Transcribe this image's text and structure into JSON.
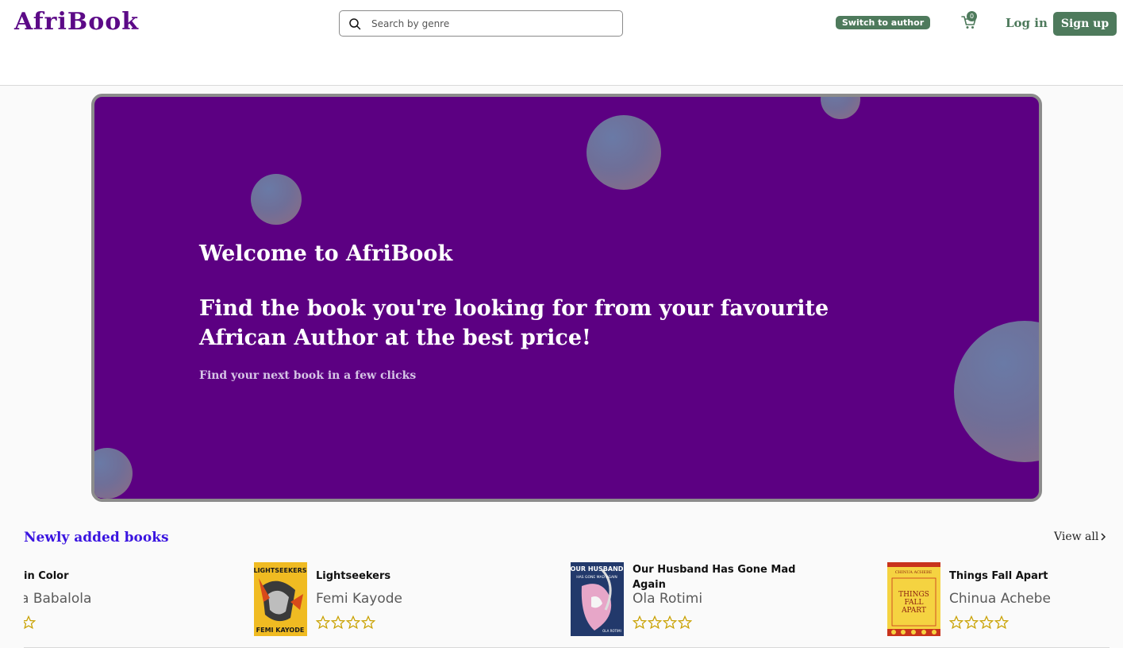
{
  "header": {
    "logo": "AfriBook",
    "search_placeholder": "Search by genre",
    "switch_label": "Switch to author",
    "cart_count": "0",
    "login_label": "Log in",
    "signup_label": "Sign up"
  },
  "hero": {
    "title": "Welcome to AfriBook",
    "headline": "Find the book you're looking for from your favourite African Author at the best price!",
    "subtitle": "Find your next book in a few clicks"
  },
  "newly_added": {
    "title": "Newly added books",
    "view_all": "View all",
    "books": [
      {
        "title": "Lightseekers",
        "author": "Femi Kayode",
        "rating": 0
      },
      {
        "title": "Our Husband Has Gone Mad Again",
        "author": "Ola Rotimi",
        "rating": 0
      },
      {
        "title": "Things Fall Apart",
        "author": "Chinua Achebe",
        "rating": 0
      }
    ],
    "partial_book": {
      "title": "in Color",
      "author": "a Babalola",
      "rating": 0
    }
  },
  "covers": {
    "lightseekers": {
      "top": "LIGHTSEEKERS",
      "bottom": "FEMI KAYODE"
    },
    "husband": {
      "top": "OUR HUSBAND",
      "middle": "HAS GONE MAD AGAIN",
      "bottom": "OLA ROTIMI"
    },
    "things": {
      "top": "CHINUA ACHEBE",
      "main": "THINGS FALL APART"
    }
  },
  "colors": {
    "brand_purple": "#5c0a87",
    "hero_bg": "#5c0082",
    "accent_green": "#4e7a5c",
    "section_blue": "#3a14e0"
  }
}
